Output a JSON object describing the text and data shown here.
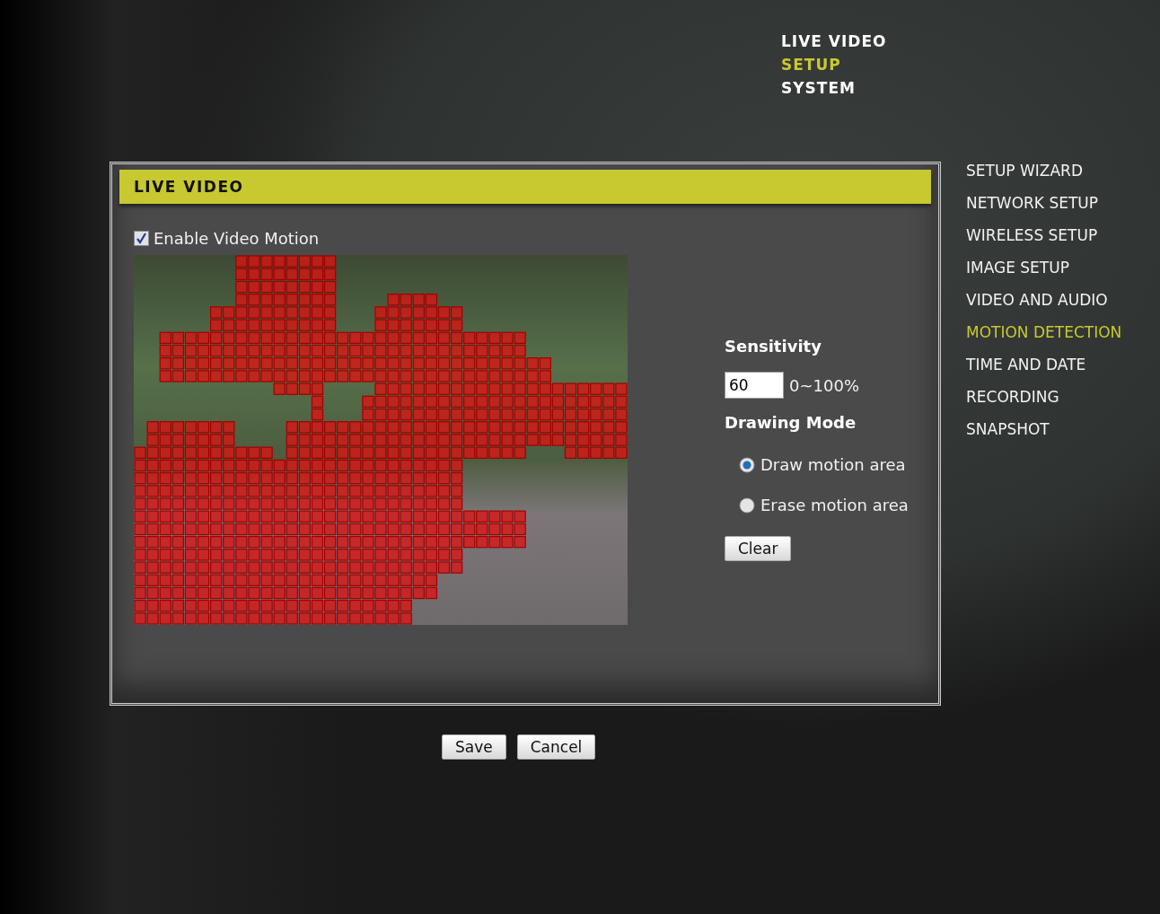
{
  "top_nav": [
    {
      "label": "LIVE VIDEO",
      "selected": false
    },
    {
      "label": "SETUP",
      "selected": true
    },
    {
      "label": "SYSTEM",
      "selected": false
    }
  ],
  "panel": {
    "title": "LIVE VIDEO",
    "enable_motion": {
      "label": "Enable Video Motion",
      "checked": true
    },
    "sensitivity": {
      "label": "Sensitivity",
      "value": "60",
      "range": "0~100%"
    },
    "drawing_mode": {
      "label": "Drawing Mode",
      "options": [
        {
          "label": "Draw motion area",
          "selected": true
        },
        {
          "label": "Erase motion area",
          "selected": false
        }
      ]
    },
    "clear_button": "Clear"
  },
  "side_menu": [
    {
      "label": "SETUP WIZARD",
      "selected": false
    },
    {
      "label": "NETWORK SETUP",
      "selected": false
    },
    {
      "label": "WIRELESS SETUP",
      "selected": false
    },
    {
      "label": "IMAGE SETUP",
      "selected": false
    },
    {
      "label": "VIDEO AND AUDIO",
      "selected": false
    },
    {
      "label": "MOTION DETECTION",
      "selected": true
    },
    {
      "label": "TIME AND DATE",
      "selected": false
    },
    {
      "label": "RECORDING",
      "selected": false
    },
    {
      "label": "SNAPSHOT",
      "selected": false
    }
  ],
  "buttons": [
    "Save",
    "Cancel"
  ]
}
